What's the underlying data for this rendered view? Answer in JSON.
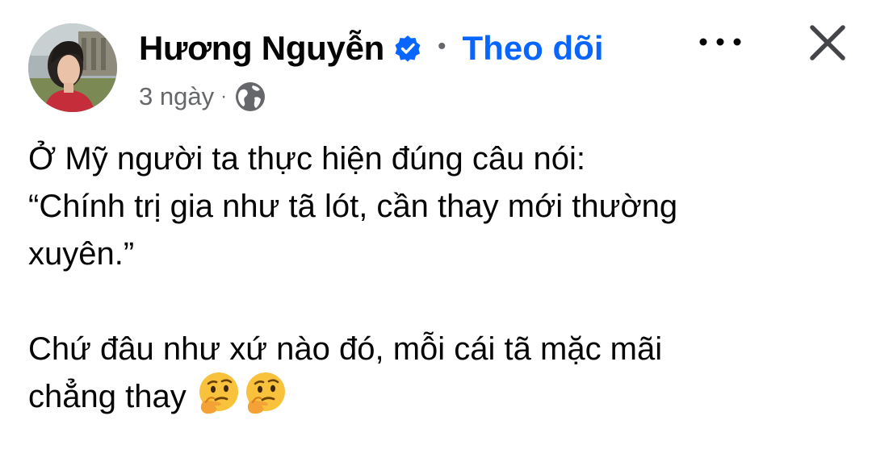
{
  "post": {
    "author_name": "Hương Nguyễn",
    "separator": "•",
    "follow_label": "Theo dõi",
    "time": "3 ngày",
    "meta_separator": "·",
    "privacy_icon": "globe-icon",
    "verified_icon": "verified-badge-icon",
    "more_icon": "more-options-icon",
    "close_icon": "close-icon",
    "text_lines": [
      "Ở Mỹ người ta thực hiện đúng câu nói:",
      "“Chính trị gia như tã lót, cần thay mới thường",
      "xuyên.”",
      "Chứ đâu như xứ nào đó, mỗi cái tã mặc mãi",
      "chẳng thay"
    ],
    "emojis": [
      "thinking-face-emoji",
      "thinking-face-emoji"
    ]
  },
  "colors": {
    "link_blue": "#0866ff",
    "text": "#050505",
    "secondary_text": "#65676b"
  }
}
